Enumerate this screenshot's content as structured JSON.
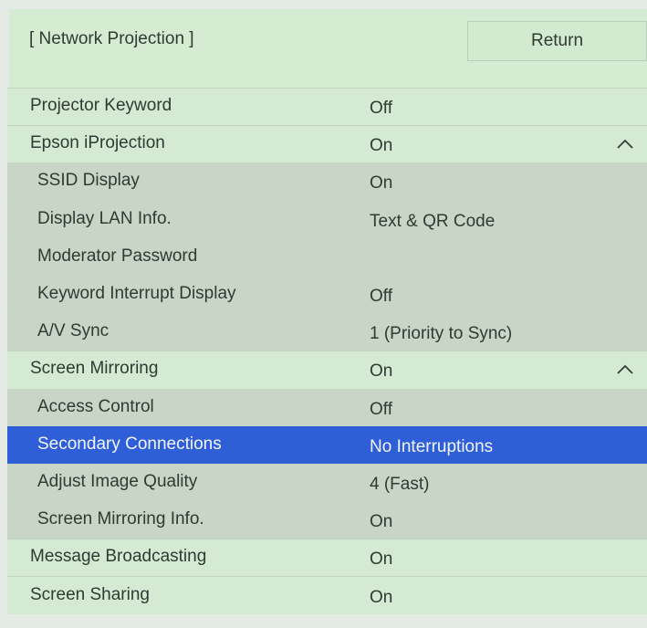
{
  "header": {
    "title": "[ Network Projection ]",
    "return_label": "Return"
  },
  "items": [
    {
      "label": "Projector Keyword",
      "value": "Off",
      "type": "top",
      "chevron": ""
    },
    {
      "label": "Epson iProjection",
      "value": "On",
      "type": "top",
      "chevron": "chevron-up-icon"
    },
    {
      "label": "SSID Display",
      "value": "On",
      "type": "sub",
      "chevron": ""
    },
    {
      "label": "Display LAN Info.",
      "value": "Text & QR Code",
      "type": "sub",
      "chevron": ""
    },
    {
      "label": "Moderator Password",
      "value": "",
      "type": "sub",
      "chevron": ""
    },
    {
      "label": "Keyword Interrupt Display",
      "value": "Off",
      "type": "sub",
      "chevron": ""
    },
    {
      "label": "A/V Sync",
      "value": "1 (Priority to Sync)",
      "type": "sub",
      "chevron": ""
    },
    {
      "label": "Screen Mirroring",
      "value": "On",
      "type": "top",
      "chevron": "chevron-up-icon"
    },
    {
      "label": "Access Control",
      "value": "Off",
      "type": "sub",
      "chevron": ""
    },
    {
      "label": "Secondary Connections",
      "value": "No Interruptions",
      "type": "sub",
      "selected": true,
      "chevron": ""
    },
    {
      "label": "Adjust Image Quality",
      "value": "4 (Fast)",
      "type": "sub",
      "chevron": ""
    },
    {
      "label": "Screen Mirroring Info.",
      "value": "On",
      "type": "sub",
      "chevron": ""
    },
    {
      "label": "Message Broadcasting",
      "value": "On",
      "type": "top",
      "chevron": ""
    },
    {
      "label": "Screen Sharing",
      "value": "On",
      "type": "top",
      "chevron": ""
    }
  ],
  "colors": {
    "top_row": "#d4ead2",
    "sub_row": "#c9d5c7",
    "selected_row": "#2f5fd6"
  }
}
